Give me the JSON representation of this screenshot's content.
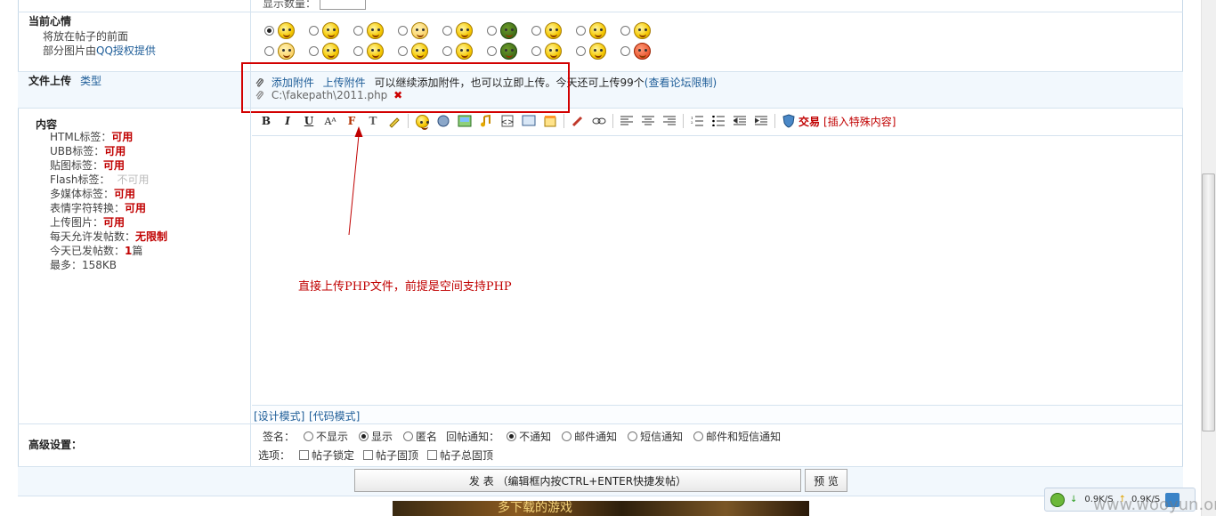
{
  "top_cut": {
    "label": "显示数量："
  },
  "mood": {
    "title": "当前心情",
    "line1": "将放在帖子的前面",
    "line2_prefix": "部分图片由",
    "line2_link": "QQ授权提供"
  },
  "emoticons": {
    "row1": [
      "smile-face",
      "grin-face",
      "happy-face",
      "love-face",
      "tongue-face",
      "turtle-face",
      "sad-face",
      "shy-face",
      "think-face"
    ],
    "row2": [
      "kiss-face",
      "angry-face",
      "cry-face",
      "shout-face",
      "laugh-face",
      "panda-face",
      "pout-face",
      "worker-face",
      "devil-face"
    ]
  },
  "upload": {
    "label": "文件上传",
    "type_link": "类型",
    "add_attachment": "添加附件",
    "upload_attachment": "上传附件",
    "notice": "可以继续添加附件，也可以立即上传。今天还可上传99个",
    "limit_link": "(查看论坛限制)",
    "file_path": "C:\\fakepath\\2011.php"
  },
  "content": {
    "title": "内容",
    "rules": [
      {
        "k": "HTML标签：",
        "v": "可用"
      },
      {
        "k": "UBB标签：",
        "v": "可用"
      },
      {
        "k": "贴图标签：",
        "v": "可用"
      },
      {
        "k": "Flash标签：",
        "v": "不可用"
      },
      {
        "k": "多媒体标签：",
        "v": "可用"
      },
      {
        "k": "表情字符转换：",
        "v": "可用"
      },
      {
        "k": "上传图片：",
        "v": "可用"
      },
      {
        "k": "每天允许发帖数：",
        "v": "无限制"
      },
      {
        "k": "今天已发帖数：",
        "v": "1",
        "suffix": "篇"
      },
      {
        "k": "最多：",
        "v": "158KB"
      }
    ]
  },
  "toolbar": {
    "trade_label": "交易",
    "insert_special": "[插入特殊内容]"
  },
  "annotation": {
    "text": "直接上传PHP文件，前提是空间支持PHP"
  },
  "modes": {
    "design": "[设计模式]",
    "code": "[代码模式]"
  },
  "advanced": {
    "title": "高级设置：",
    "sign_label": "签名：",
    "sign_opts": [
      "不显示",
      "显示",
      "匿名"
    ],
    "reply_label": "回帖通知：",
    "reply_opts": [
      "不通知",
      "邮件通知",
      "短信通知",
      "邮件和短信通知"
    ],
    "options_label": "选项：",
    "options": [
      "帖子锁定",
      "帖子固顶",
      "帖子总固顶"
    ]
  },
  "buttons": {
    "submit": "发 表 （编辑框内按CTRL+ENTER快捷发帖）",
    "preview": "预 览"
  },
  "netmeter": {
    "down": "0.9K/S",
    "up": "0.9K/S"
  },
  "banner": {
    "text": "多下载的游戏"
  },
  "watermark": "www.wooyun.org"
}
